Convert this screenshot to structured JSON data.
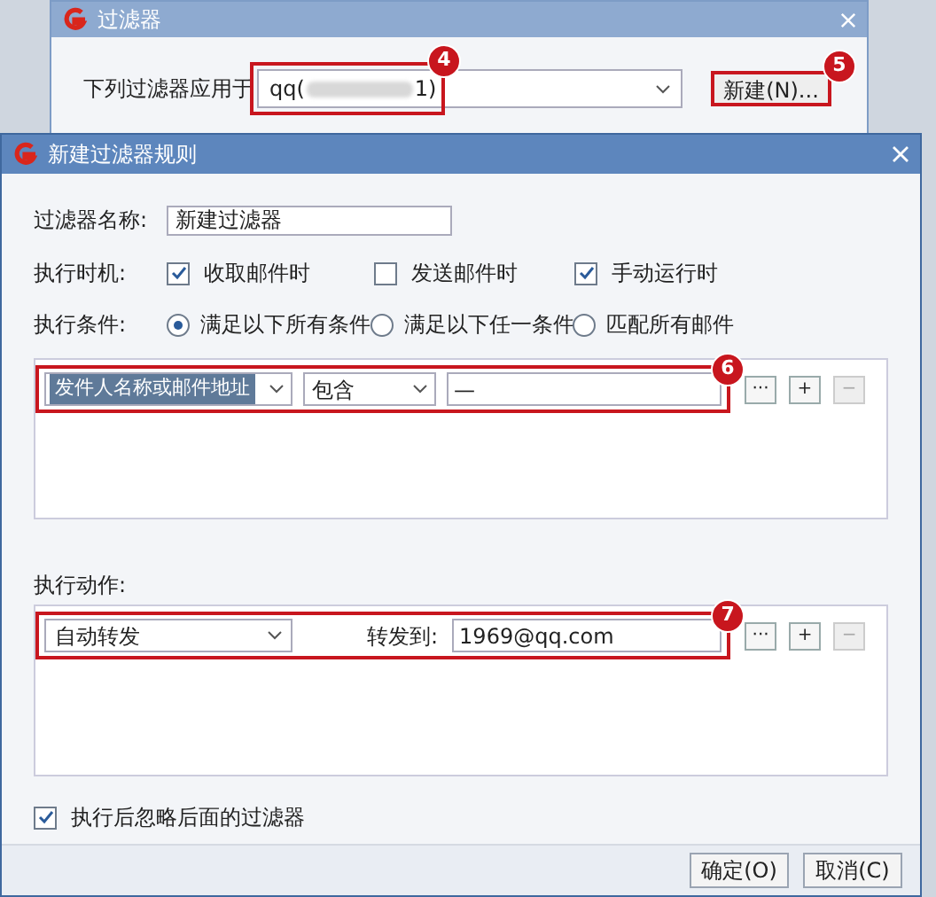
{
  "background_window": {
    "title": "过滤器",
    "apply_label": "下列过滤器应用于",
    "account_prefix": "qq(",
    "account_suffix": "1)",
    "account_badge": "4",
    "new_button": "新建(N)...",
    "new_badge": "5"
  },
  "dialog": {
    "title": "新建过滤器规则",
    "name_label": "过滤器名称:",
    "name_value": "新建过滤器",
    "timing_label": "执行时机:",
    "timing": [
      {
        "label": "收取邮件时",
        "checked": true
      },
      {
        "label": "发送邮件时",
        "checked": false
      },
      {
        "label": "手动运行时",
        "checked": true
      }
    ],
    "condition_label": "执行条件:",
    "condition_modes": [
      {
        "label": "满足以下所有条件",
        "selected": true
      },
      {
        "label": "满足以下任一条件",
        "selected": false
      },
      {
        "label": "匹配所有邮件",
        "selected": false
      }
    ],
    "conditions": [
      {
        "field": "发件人名称或邮件地址",
        "operator": "包含",
        "value": "—",
        "badge": "6",
        "buttons": [
          {
            "label": "···",
            "disabled": false
          },
          {
            "label": "+",
            "disabled": false
          },
          {
            "label": "−",
            "disabled": true
          }
        ]
      }
    ],
    "action_label": "执行动作:",
    "actions": [
      {
        "action": "自动转发",
        "target_label": "转发到:",
        "target": "1969@qq.com",
        "badge": "7",
        "buttons": [
          {
            "label": "···",
            "disabled": false
          },
          {
            "label": "+",
            "disabled": false
          },
          {
            "label": "−",
            "disabled": true
          }
        ]
      }
    ],
    "stop_after": {
      "label": "执行后忽略后面的过滤器",
      "checked": true
    },
    "buttons": [
      "确定(O)",
      "取消(C)"
    ]
  }
}
